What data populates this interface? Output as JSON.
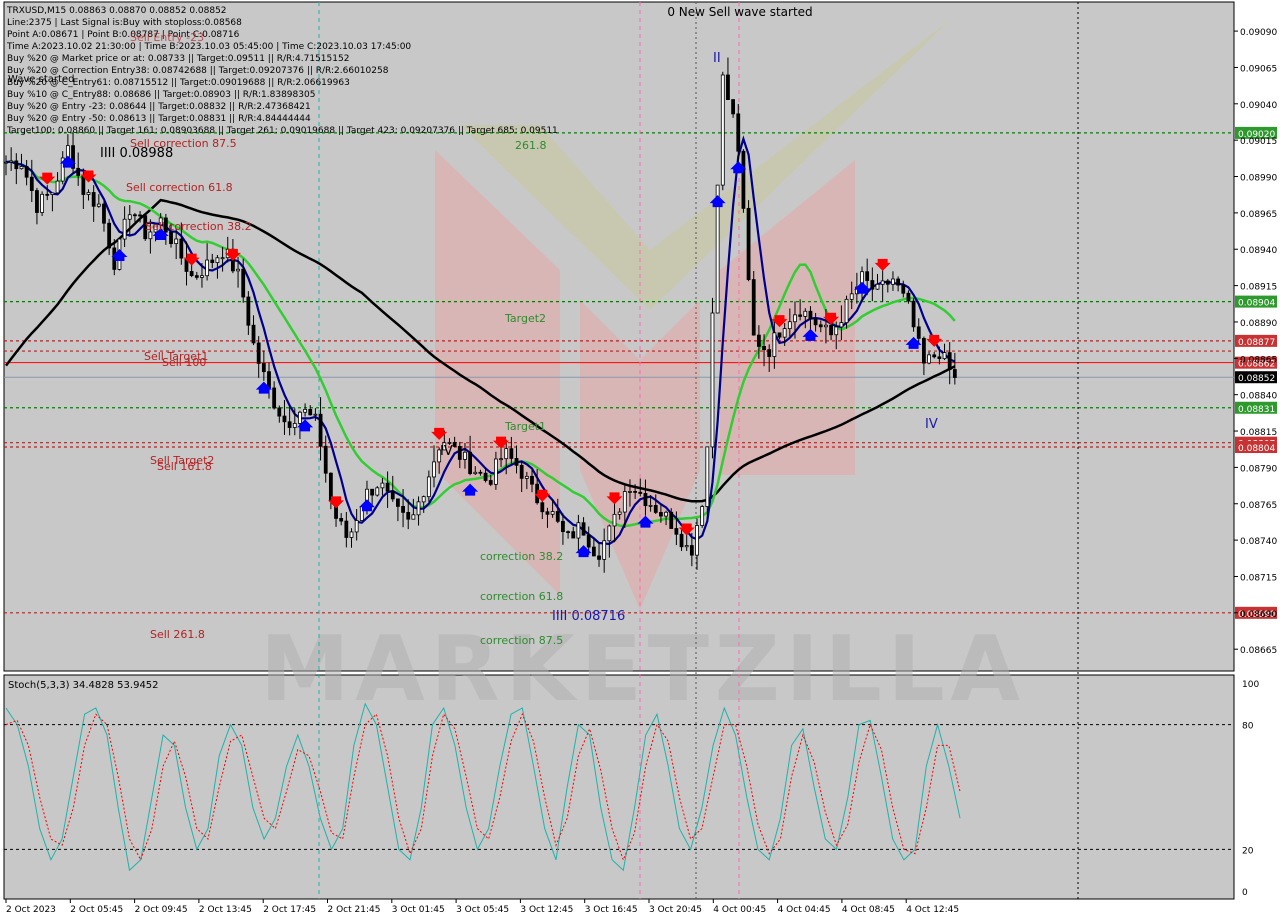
{
  "colors": {
    "background": "#ffffff",
    "plot_bg": "#c8c8c8",
    "candle": "#000000",
    "ma_fast": "#00008b",
    "ma_mid": "#32cd32",
    "ma_slow": "#000000",
    "green_level": "#008000",
    "red_level": "#b22222",
    "buy_arrow": "#0000ff",
    "sell_arrow": "#ff0000",
    "stoch_main": "#20b2aa",
    "stoch_signal": "#ff0000",
    "vline_cyan": "#20b2aa",
    "vline_pink": "#ff69b4"
  },
  "info_panel": {
    "lines": [
      "TRXUSD,M15  0.08863 0.08870 0.08852 0.08852",
      "Line:2375 | Last Signal is:Buy with stoploss:0.08568",
      "Point A:0.08671 | Point B:0.08787 | Point C:0.08716",
      "Time A:2023.10.02 21:30:00 | Time B:2023.10.03 05:45:00 | Time C:2023.10.03 17:45:00",
      "Buy %20 @ Market price or at: 0.08733 || Target:0.09511 || R/R:4.71515152",
      "Buy %20 @ Correction Entry38: 0.08742688 || Target:0.09207376 || R/R:2.66010258",
      "Buy %20 @ C_Entry61: 0.08715512 || Target:0.09019688 || R/R:2.06619963",
      "Buy %10 @ C_Entry88: 0.08686 || Target:0.08903 || R/R:1.83898305",
      "Buy %20 @ Entry -23: 0.08644 || Target:0.08832 || R/R:2.47368421",
      "Buy %20 @ Entry -50: 0.08613 || Target:0.08831 || R/R:4.84444444",
      "Target100: 0.08860 || Target 161: 0.08903688 || Target 261: 0.09019688 || Target 423: 0.09207376 || Target 685: 0.09511"
    ],
    "overlay_labels": [
      "Sell Entry -23",
      "Wave started",
      "IIII 0.08988"
    ]
  },
  "top_notice": "0 New Sell wave started",
  "chart_data": [
    {
      "type": "candlestick",
      "symbol": "TRXUSD",
      "timeframe": "M15",
      "ylim": [
        0.0865,
        0.0911
      ],
      "y_ticks": [
        "0.09090",
        "0.09065",
        "0.09040",
        "0.09015",
        "0.08990",
        "0.08965",
        "0.08940",
        "0.08915",
        "0.08890",
        "0.08865",
        "0.08840",
        "0.08815",
        "0.08790",
        "0.08765",
        "0.08740",
        "0.08715",
        "0.08690",
        "0.08665"
      ],
      "x_ticks": [
        "2 Oct 2023",
        "2 Oct 05:45",
        "2 Oct 09:45",
        "2 Oct 13:45",
        "2 Oct 17:45",
        "2 Oct 21:45",
        "3 Oct 01:45",
        "3 Oct 05:45",
        "3 Oct 12:45",
        "3 Oct 16:45",
        "3 Oct 20:45",
        "4 Oct 00:45",
        "4 Oct 04:45",
        "4 Oct 08:45",
        "4 Oct 12:45"
      ],
      "close_path": [
        0.09,
        0.09,
        0.0897,
        0.0898,
        0.0901,
        0.0898,
        0.0897,
        0.0893,
        0.0897,
        0.0895,
        0.0896,
        0.0894,
        0.0892,
        0.0893,
        0.0894,
        0.0892,
        0.0887,
        0.0884,
        0.0882,
        0.0883,
        0.0882,
        0.0876,
        0.0874,
        0.0877,
        0.0878,
        0.0876,
        0.0875,
        0.0878,
        0.0881,
        0.088,
        0.0879,
        0.0878,
        0.088,
        0.0879,
        0.0877,
        0.0876,
        0.0874,
        0.0875,
        0.0873,
        0.0875,
        0.0878,
        0.0877,
        0.0876,
        0.0875,
        0.0873,
        0.0878,
        0.0906,
        0.0902,
        0.0888,
        0.0887,
        0.0889,
        0.089,
        0.0889,
        0.0888,
        0.089,
        0.0892,
        0.0891,
        0.0892,
        0.089,
        0.0886,
        0.0887,
        0.0885
      ],
      "last_price": 0.08852,
      "level_lines": [
        {
          "price": 0.0902,
          "label": "0.09020",
          "kind": "green"
        },
        {
          "price": 0.08904,
          "label": "0.08904",
          "kind": "green"
        },
        {
          "price": 0.08877,
          "label": "0.08877",
          "kind": "red"
        },
        {
          "price": 0.0887,
          "label": "",
          "kind": "red"
        },
        {
          "price": 0.08862,
          "label": "0.08862",
          "kind": "redsolid"
        },
        {
          "price": 0.08852,
          "label": "0.08852",
          "kind": "current"
        },
        {
          "price": 0.08831,
          "label": "0.08831",
          "kind": "green"
        },
        {
          "price": 0.08807,
          "label": "0.08807",
          "kind": "red"
        },
        {
          "price": 0.08804,
          "label": "0.08804",
          "kind": "red"
        },
        {
          "price": 0.0869,
          "label": "0.08690",
          "kind": "red"
        }
      ],
      "annotations": [
        {
          "text": "261.8",
          "color": "green"
        },
        {
          "text": "Sell correction 87.5",
          "color": "red"
        },
        {
          "text": "Sell correction 61.8",
          "color": "red"
        },
        {
          "text": "Sell correction 38.2",
          "color": "red"
        },
        {
          "text": "Target2",
          "color": "green"
        },
        {
          "text": "Sell Target1",
          "color": "red"
        },
        {
          "text": "Sell 100",
          "color": "red"
        },
        {
          "text": "Target1",
          "color": "green"
        },
        {
          "text": "Sell Target2",
          "color": "red"
        },
        {
          "text": "Sell 161.8",
          "color": "red"
        },
        {
          "text": "correction 38.2",
          "color": "green"
        },
        {
          "text": "correction 61.8",
          "color": "green"
        },
        {
          "text": "correction 87.5",
          "color": "green"
        },
        {
          "text": "Sell 261.8",
          "color": "red"
        },
        {
          "text": "IIII 0.08716",
          "color": "blue"
        },
        {
          "text": "IV",
          "color": "black"
        },
        {
          "text": "II",
          "color": "blue"
        },
        {
          "text": "IV",
          "color": "blue"
        }
      ],
      "watermark": "MARKETZILLA"
    },
    {
      "type": "line",
      "title": "Stoch(5,3,3) 34.4828 53.9452",
      "ylim": [
        0,
        100
      ],
      "y_ticks": [
        "100",
        "80",
        "20",
        "0"
      ],
      "levels": [
        80,
        20
      ],
      "series": [
        {
          "name": "main",
          "values": [
            88,
            80,
            60,
            30,
            15,
            25,
            55,
            85,
            88,
            75,
            40,
            10,
            15,
            45,
            75,
            70,
            40,
            20,
            30,
            65,
            80,
            70,
            40,
            25,
            35,
            60,
            75,
            60,
            35,
            20,
            30,
            70,
            90,
            80,
            50,
            20,
            15,
            40,
            80,
            88,
            70,
            40,
            20,
            30,
            60,
            85,
            88,
            60,
            30,
            15,
            50,
            80,
            75,
            40,
            15,
            10,
            40,
            75,
            85,
            60,
            30,
            20,
            40,
            70,
            88,
            75,
            45,
            20,
            15,
            35,
            70,
            78,
            50,
            25,
            20,
            45,
            80,
            82,
            55,
            25,
            15,
            20,
            60,
            80,
            60,
            35
          ]
        },
        {
          "name": "signal",
          "values": [
            80,
            82,
            70,
            45,
            25,
            22,
            40,
            70,
            85,
            80,
            55,
            25,
            15,
            30,
            60,
            72,
            55,
            30,
            25,
            50,
            72,
            75,
            55,
            35,
            30,
            48,
            68,
            65,
            48,
            28,
            25,
            55,
            80,
            85,
            65,
            35,
            18,
            30,
            65,
            85,
            78,
            55,
            30,
            25,
            45,
            72,
            85,
            72,
            45,
            22,
            35,
            65,
            78,
            58,
            30,
            15,
            28,
            60,
            80,
            72,
            45,
            25,
            30,
            55,
            80,
            80,
            60,
            32,
            18,
            25,
            55,
            75,
            62,
            38,
            22,
            32,
            62,
            80,
            68,
            40,
            20,
            18,
            40,
            70,
            70,
            48
          ]
        }
      ]
    }
  ]
}
